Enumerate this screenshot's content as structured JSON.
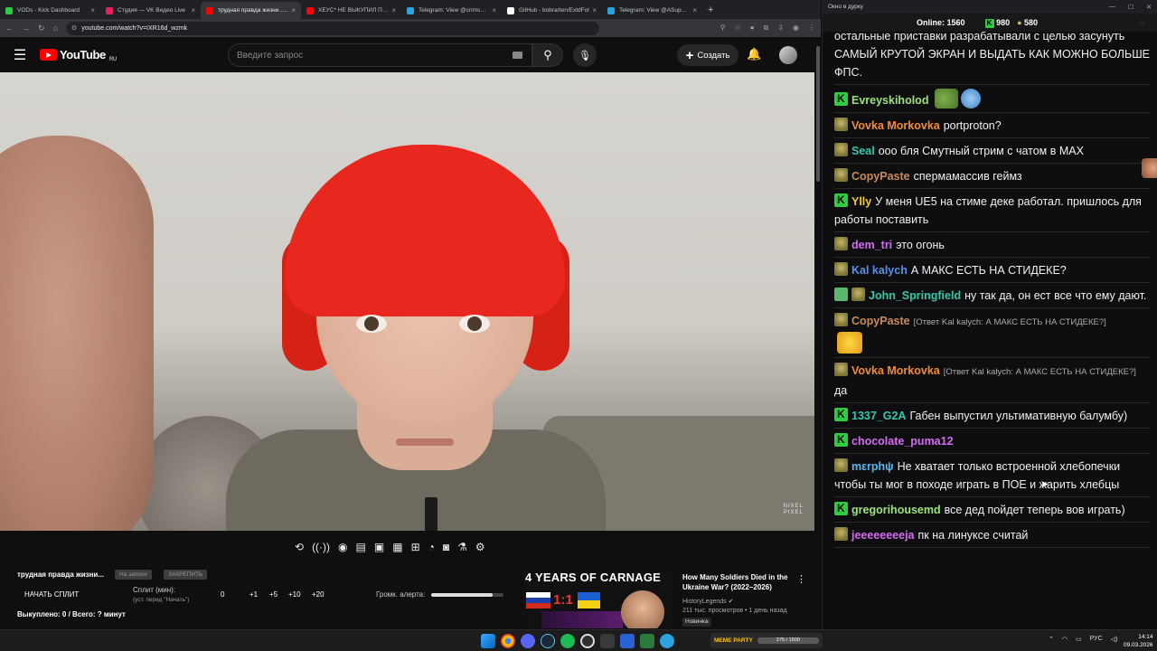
{
  "browser": {
    "tabs": [
      {
        "label": "VODs - Kick Dashboard",
        "color": "#2ecc40",
        "active": false
      },
      {
        "label": "Студия — VK Видео Live",
        "color": "#e91e63",
        "active": false
      },
      {
        "label": "трудная правда жизни... - Y",
        "color": "#ff0000",
        "active": true
      },
      {
        "label": "ХЕУС* НЕ ВЫКУПИЛ ПОС",
        "color": "#ff0000",
        "active": false
      },
      {
        "label": "Telegram: View @crimsoncb",
        "color": "#2aa3e0",
        "active": false
      },
      {
        "label": "GitHub - bobrarten/ExtdFol",
        "color": "#ffffff",
        "active": false
      },
      {
        "label": "Telegram: View @ASupersh",
        "color": "#2aa3e0",
        "active": false
      }
    ],
    "url": "youtube.com/watch?v=IXR16d_wzmk"
  },
  "youtube": {
    "logo": "YouTube",
    "region": "RU",
    "search_placeholder": "Введите запрос",
    "create_label": "Создать",
    "watermark": "NIXEL\nPIXEL"
  },
  "split_panel": {
    "title": "трудная правда жизни...",
    "pill1": "На записи",
    "pill2": "ЗАКРЕПИТЬ",
    "start_label": "НАЧАТЬ СПЛИТ",
    "split_label": "Сплит (мин):",
    "split_hint": "(уст. перед \"Начать\")",
    "numbers": [
      "0",
      "+1",
      "+5",
      "+10",
      "+20"
    ],
    "alert_label": "Громк. алерта:",
    "alert_level": 0.85,
    "stats": "Выкуплено: 0 / Всего: ? минут"
  },
  "recommendation": {
    "thumb_banner": "4 YEARS OF CARNAGE",
    "thumb_score": "1:1",
    "title": "How Many Soldiers Died in the Ukraine War? (2022–2026)",
    "channel": "HistoryLegends",
    "meta": "211 тыс. просмотров • 1 день назад",
    "badge": "Новинка"
  },
  "chat": {
    "window_title": "Окно в дурку",
    "online_label": "Online:",
    "online": "1560",
    "stat_a": "980",
    "stat_b": "580",
    "messages": [
      {
        "user": "",
        "color": "#ffffff",
        "badge": "none",
        "text": "остальные приставки разрабатывали с целью засунуть САМЫЙ КРУТОЙ ЭКРАН И ВЫДАТЬ КАК МОЖНО БОЛЬШЕ ФПС.",
        "reply": ""
      },
      {
        "user": "Evreyskiholod",
        "color": "#9be37a",
        "badge": "k",
        "text": "",
        "reply": "",
        "emotes": [
          "pepe",
          "blue"
        ]
      },
      {
        "user": "Vovka Morkovka",
        "color": "#f08a3a",
        "badge": "frog",
        "text": "portproton?",
        "reply": ""
      },
      {
        "user": "Seal",
        "color": "#35c6a8",
        "badge": "frog",
        "text": "ооо бля Смутный стрим с чатом в MAX",
        "reply": ""
      },
      {
        "user": "CopyPaste",
        "color": "#c98a5a",
        "badge": "frog",
        "text": "спермамассив геймз",
        "reply": ""
      },
      {
        "user": "Ylly",
        "color": "#f0c93a",
        "badge": "k",
        "text": "У меня UE5 на стиме деке работал. пришлось для работы поставить",
        "reply": ""
      },
      {
        "user": "dem_tri",
        "color": "#d36bf0",
        "badge": "frog",
        "text": "это огонь",
        "reply": ""
      },
      {
        "user": "Kal kalych",
        "color": "#5a8fe8",
        "badge": "frog",
        "text": "А МАКС ЕСТЬ НА СТИДЕКЕ?",
        "reply": ""
      },
      {
        "user": "John_Springfield",
        "color": "#35c6a8",
        "badge": "pen",
        "text": "ну так да, он ест все что ему дают.",
        "reply": ""
      },
      {
        "user": "CopyPaste",
        "color": "#c98a5a",
        "badge": "frog",
        "text": "",
        "reply": "[Ответ Kal kalych: А МАКС ЕСТЬ НА СТИДЕКЕ?]",
        "emotes": [
          "yellow"
        ]
      },
      {
        "user": "Vovka Morkovka",
        "color": "#f08a3a",
        "badge": "frog",
        "text": "да",
        "reply": "[Ответ Kal kalych: А МАКС ЕСТЬ НА СТИДЕКЕ?]"
      },
      {
        "user": "1337_G2A",
        "color": "#35c6a8",
        "badge": "k",
        "text": "Габен выпустил ультимативную балумбу)",
        "reply": ""
      },
      {
        "user": "chocolate_puma12",
        "color": "#d36bf0",
        "badge": "k",
        "text": "",
        "reply": "",
        "emotes": [
          "face"
        ]
      },
      {
        "user": "mεrphψ",
        "color": "#5ab8f0",
        "badge": "frog",
        "text": "Не хватает только встроенной хлебопечки чтобы ты мог в походе играть в ПОЕ и жарить хлебцы",
        "reply": ""
      },
      {
        "user": "gregorihousemd",
        "color": "#9be37a",
        "badge": "k",
        "text": "все дед пойдет теперь вов играть)",
        "reply": ""
      },
      {
        "user": "jeeeeeeeeja",
        "color": "#d36bf0",
        "badge": "frog",
        "text": "пк на линуксе считай",
        "reply": ""
      }
    ]
  },
  "taskbar": {
    "memeparty_label": "MEME PARTY",
    "memeparty_progress": "275 / 1500",
    "lang": "РУС",
    "time": "14:14",
    "date": "09.03.2026"
  }
}
